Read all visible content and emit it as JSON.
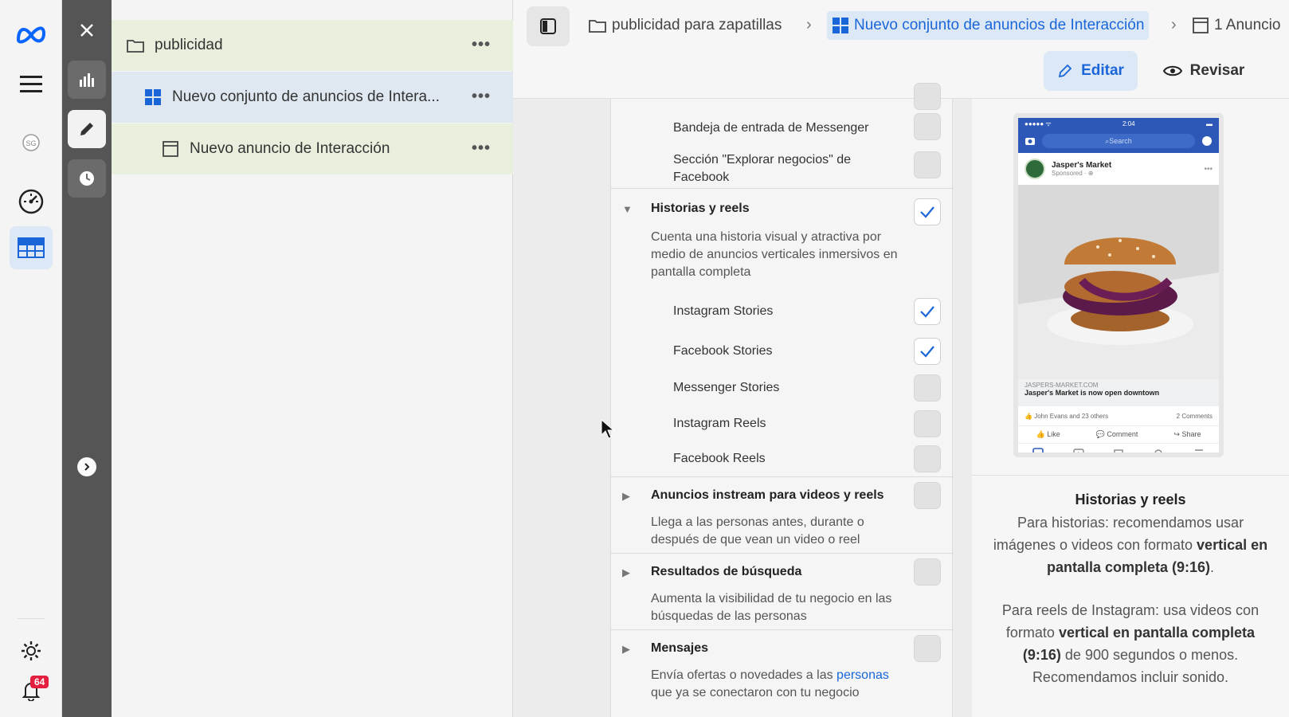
{
  "rail": {
    "notification_count": "64"
  },
  "tree": {
    "items": [
      {
        "label": "publicidad"
      },
      {
        "label": "Nuevo conjunto de anuncios de Intera..."
      },
      {
        "label": "Nuevo anuncio de Interacción"
      }
    ]
  },
  "header": {
    "breadcrumbs": [
      {
        "label": "publicidad para zapatillas"
      },
      {
        "label": "Nuevo conjunto de anuncios de Interacción"
      },
      {
        "label": "1 Anuncio"
      }
    ],
    "edit_label": "Editar",
    "review_label": "Revisar"
  },
  "placements": {
    "messenger_inbox": "Bandeja de entrada de Messenger",
    "explore_business": "Sección \"Explorar negocios\" de Facebook",
    "stories_reels": {
      "title": "Historias y reels",
      "desc": "Cuenta una historia visual y atractiva por medio de anuncios verticales inmersivos en pantalla completa",
      "items": [
        {
          "label": "Instagram Stories",
          "checked": true
        },
        {
          "label": "Facebook Stories",
          "checked": true
        },
        {
          "label": "Messenger Stories",
          "checked": false
        },
        {
          "label": "Instagram Reels",
          "checked": false
        },
        {
          "label": "Facebook Reels",
          "checked": false
        }
      ]
    },
    "instream": {
      "title": "Anuncios instream para videos y reels",
      "desc": "Llega a las personas antes, durante o después de que vean un video o reel"
    },
    "search": {
      "title": "Resultados de búsqueda",
      "desc": "Aumenta la visibilidad de tu negocio en las búsquedas de las personas"
    },
    "messages": {
      "title": "Mensajes",
      "desc_pre": "Envía ofertas o novedades a las",
      "desc_link": "personas",
      "desc_post": "que ya se conectaron con tu negocio"
    }
  },
  "preview": {
    "phone": {
      "time": "2:04",
      "search": "Search",
      "page_name": "Jasper's Market",
      "sponsored": "Sponsored · ⊕",
      "url": "JASPERS-MARKET.COM",
      "headline": "Jasper's Market is now open downtown",
      "reactions": "John Evans and 23 others",
      "comments": "2 Comments",
      "like": "Like",
      "comment": "Comment",
      "share": "Share"
    },
    "title": "Historias y reels",
    "p1_pre": "Para historias: recomendamos usar imágenes o videos con formato",
    "p1_bold": "vertical en pantalla completa (9:16)",
    "p1_post": ".",
    "p2_pre": "Para reels de Instagram: usa videos con formato",
    "p2_bold": "vertical en pantalla completa (9:16)",
    "p2_post": "de 900 segundos o menos. Recomendamos incluir sonido."
  },
  "colors": {
    "accent": "#1a66d9",
    "tree_green": "#e8efdc",
    "tree_blue": "#dfe8f1",
    "strip": "#555555"
  }
}
